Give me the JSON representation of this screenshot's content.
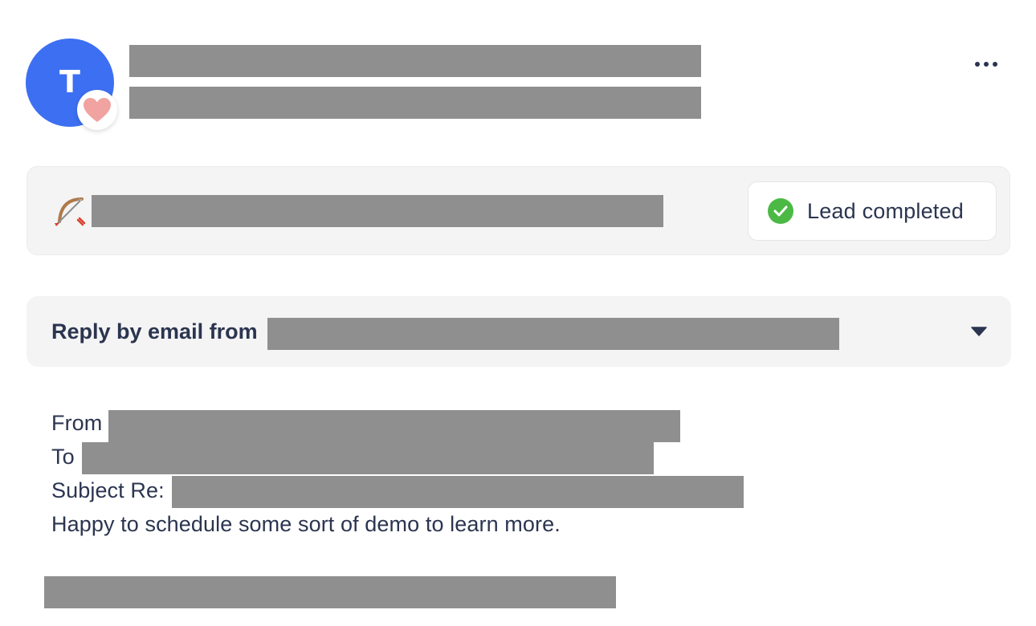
{
  "header": {
    "avatar_letter": "T",
    "avatar_color": "#3d6ff2",
    "avatar_badge_icon": "heart-icon",
    "menu_icon": "more-horizontal-icon"
  },
  "lead": {
    "icon": "bow-and-arrow-icon",
    "status_label": "Lead completed",
    "status_icon": "check-circle-icon",
    "status_color": "#4cb944"
  },
  "reply": {
    "title": "Reply by email from",
    "toggle_icon": "caret-down-icon"
  },
  "email": {
    "from_label": "From",
    "to_label": "To",
    "subject_label": "Subject Re:",
    "body": "Happy to schedule some sort of demo to learn more."
  }
}
